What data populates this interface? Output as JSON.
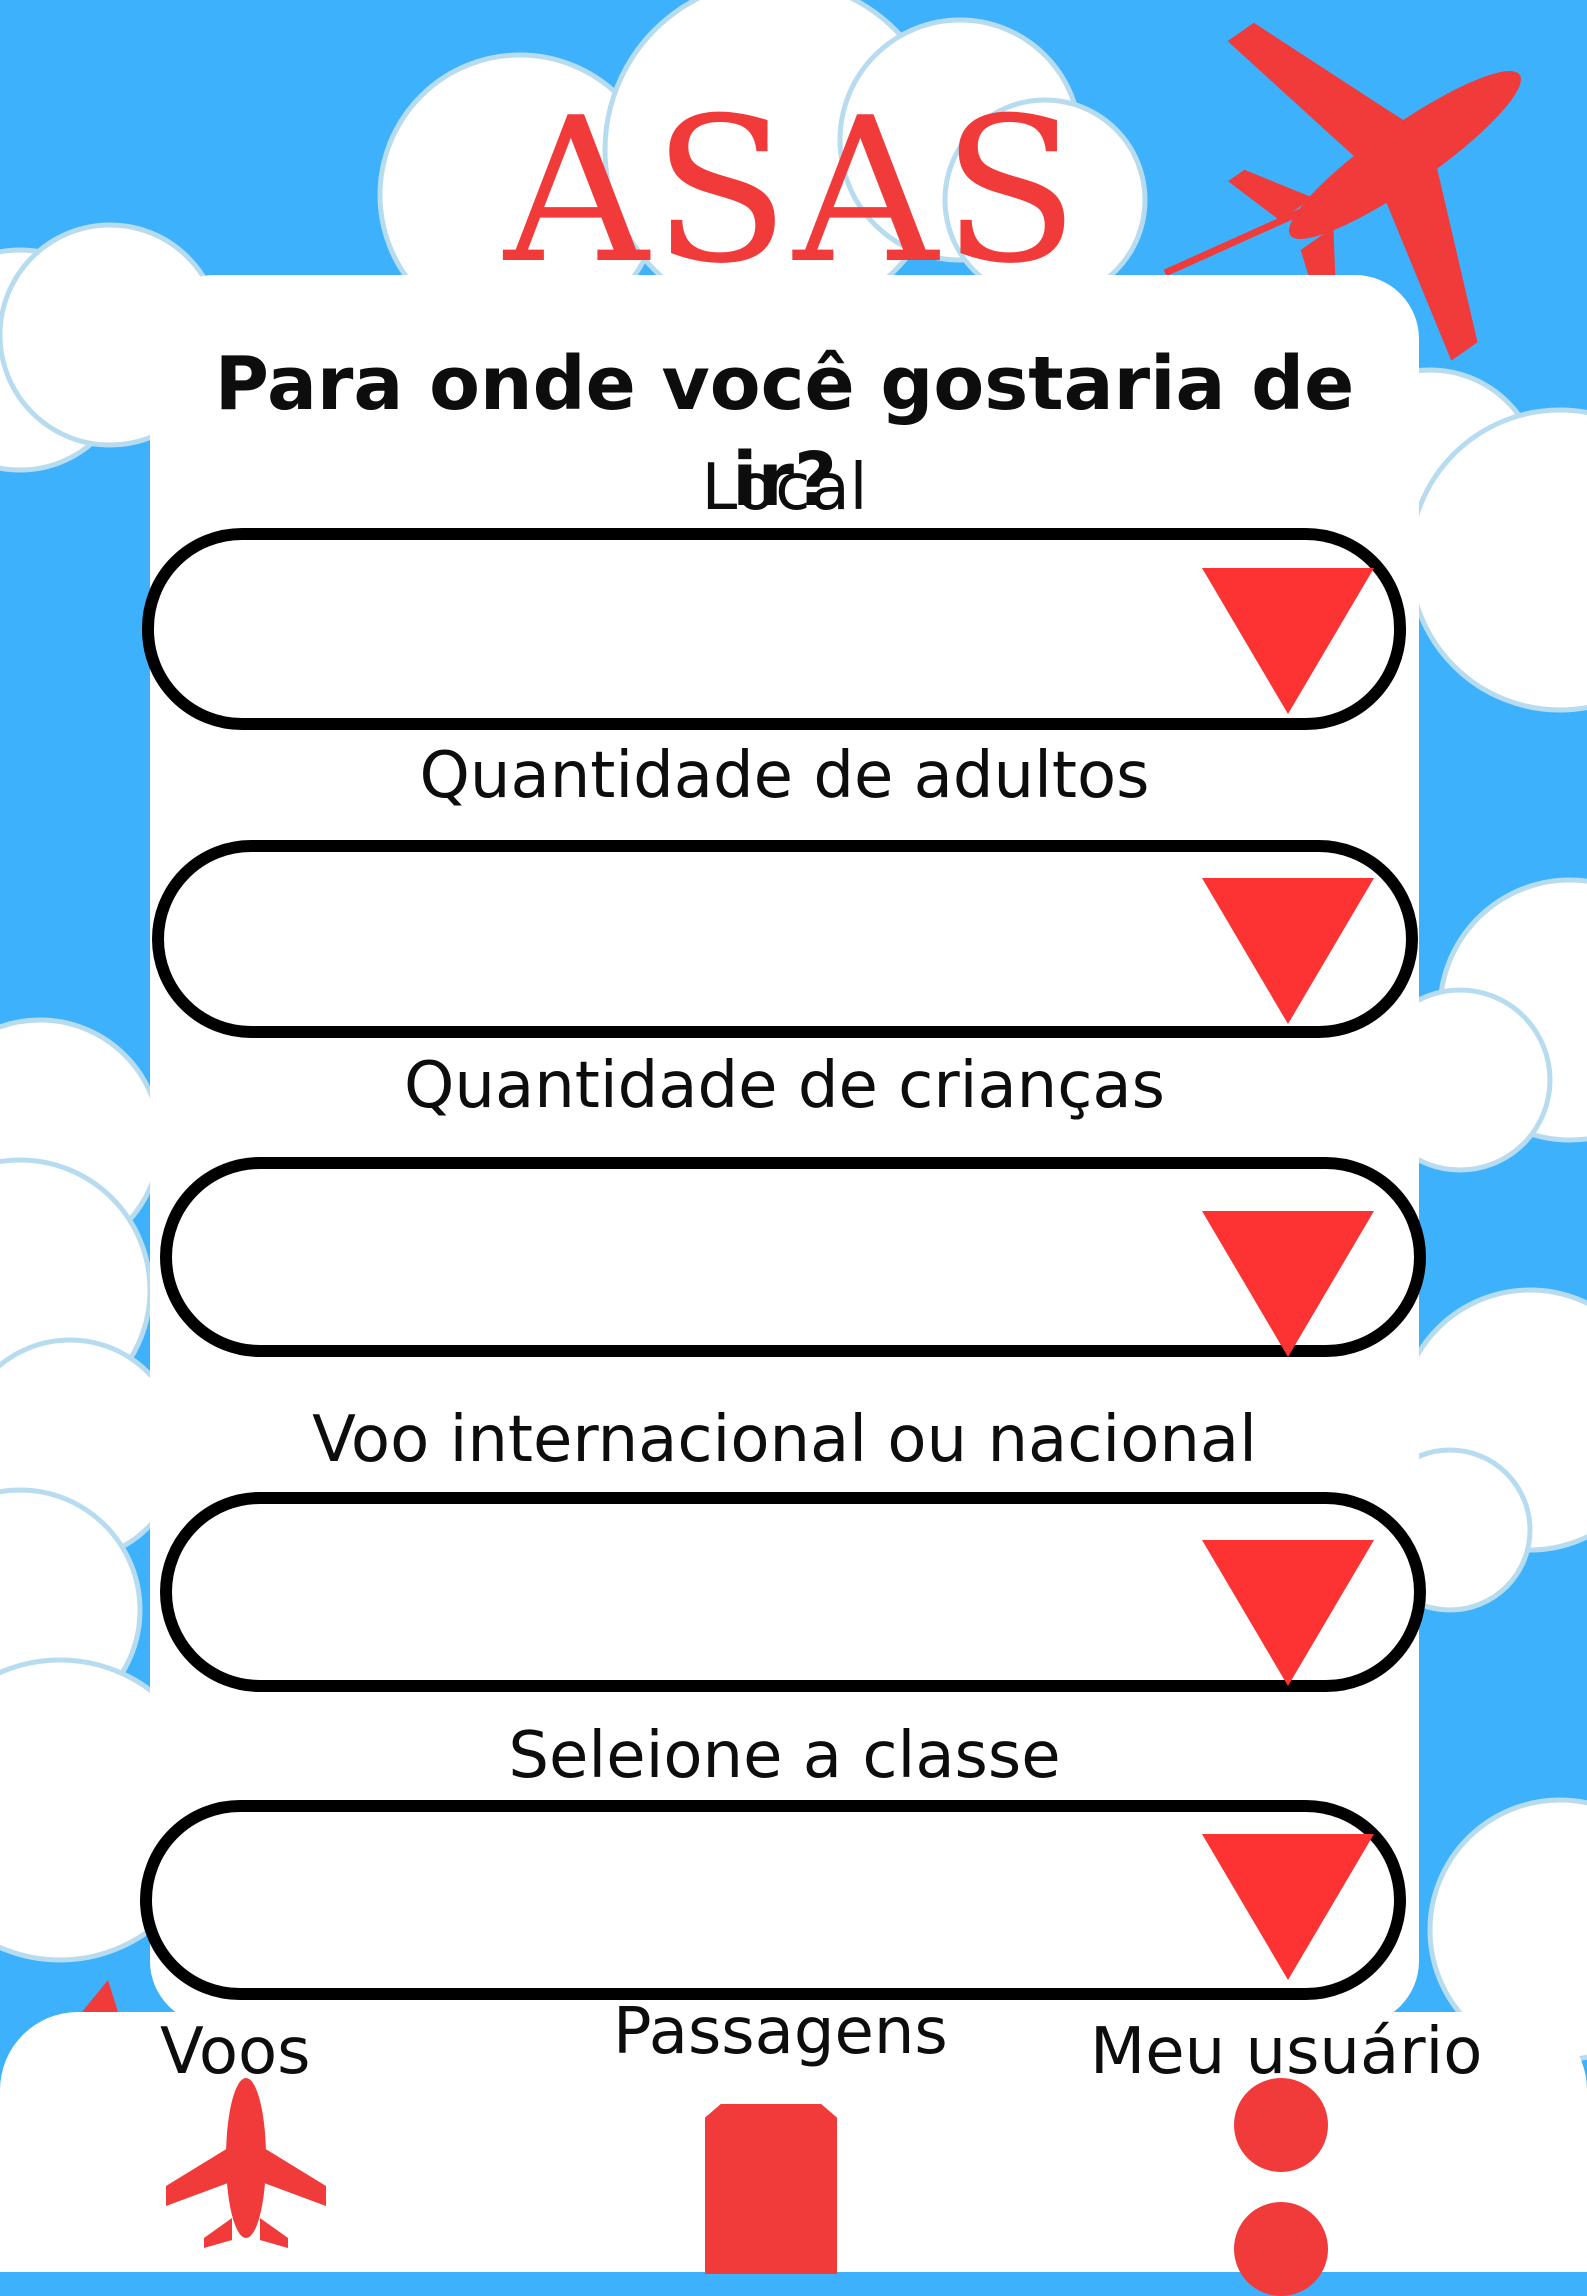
{
  "brand": {
    "name": "ASAS",
    "accent": "#fd3232",
    "sky": "#3db1fb",
    "cloud": "#ffffff"
  },
  "form": {
    "title": "Para onde você gostaria de ir?",
    "fields": [
      {
        "label": "Local",
        "value": "",
        "icon": "chevron-down-icon"
      },
      {
        "label": "Quantidade de adultos",
        "value": "",
        "icon": "chevron-down-icon"
      },
      {
        "label": "Quantidade de crianças",
        "value": "",
        "icon": "chevron-down-icon"
      },
      {
        "label": "Voo internacional ou nacional",
        "value": "",
        "icon": "chevron-down-icon"
      },
      {
        "label": "Seleione a classe",
        "value": "",
        "icon": "chevron-down-icon"
      }
    ]
  },
  "nav": {
    "items": [
      {
        "label": "Voos",
        "icon": "airplane-icon"
      },
      {
        "label": "Passagens",
        "icon": "ticket-icon"
      },
      {
        "label": "Meu usuário",
        "icon": "user-icon"
      }
    ]
  }
}
